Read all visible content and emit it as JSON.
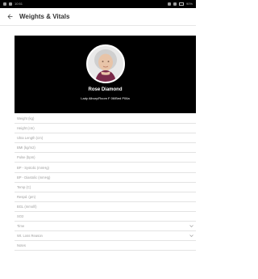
{
  "app": {
    "title": "Weights & Vitals",
    "status": {
      "left_text": "10:51",
      "right_text": "90%"
    }
  },
  "patient": {
    "name": "Rose Diamond",
    "location": "Lady Albury/Room F 06/Bed P06a"
  },
  "fields": [
    {
      "label": "Weight (kg)",
      "type": "input"
    },
    {
      "label": "Height (cm)",
      "type": "input"
    },
    {
      "label": "Ulna Length (cm)",
      "type": "input"
    },
    {
      "label": "BMI (kg/m2)",
      "type": "input"
    },
    {
      "label": "Pulse (bpm)",
      "type": "input"
    },
    {
      "label": "BP - Systolic (mmHg)",
      "type": "input"
    },
    {
      "label": "BP - Diastolic (mmHg)",
      "type": "input"
    },
    {
      "label": "Temp (C)",
      "type": "input"
    },
    {
      "label": "Respd. (pm)",
      "type": "input"
    },
    {
      "label": "BGL (mmol/l)",
      "type": "input"
    },
    {
      "label": "SO2",
      "type": "input"
    },
    {
      "label": "Time",
      "type": "dropdown"
    },
    {
      "label": "Wt. Loss Reason",
      "type": "dropdown"
    },
    {
      "label": "Notes",
      "type": "input"
    }
  ],
  "colors": {
    "header_bg": "#000000",
    "divider": "#e3e3e3",
    "label_text": "#9e9e9e"
  },
  "icons": {
    "back": "arrow-left-icon",
    "avatar": "patient-avatar",
    "dropdown": "chevron-down-icon"
  }
}
